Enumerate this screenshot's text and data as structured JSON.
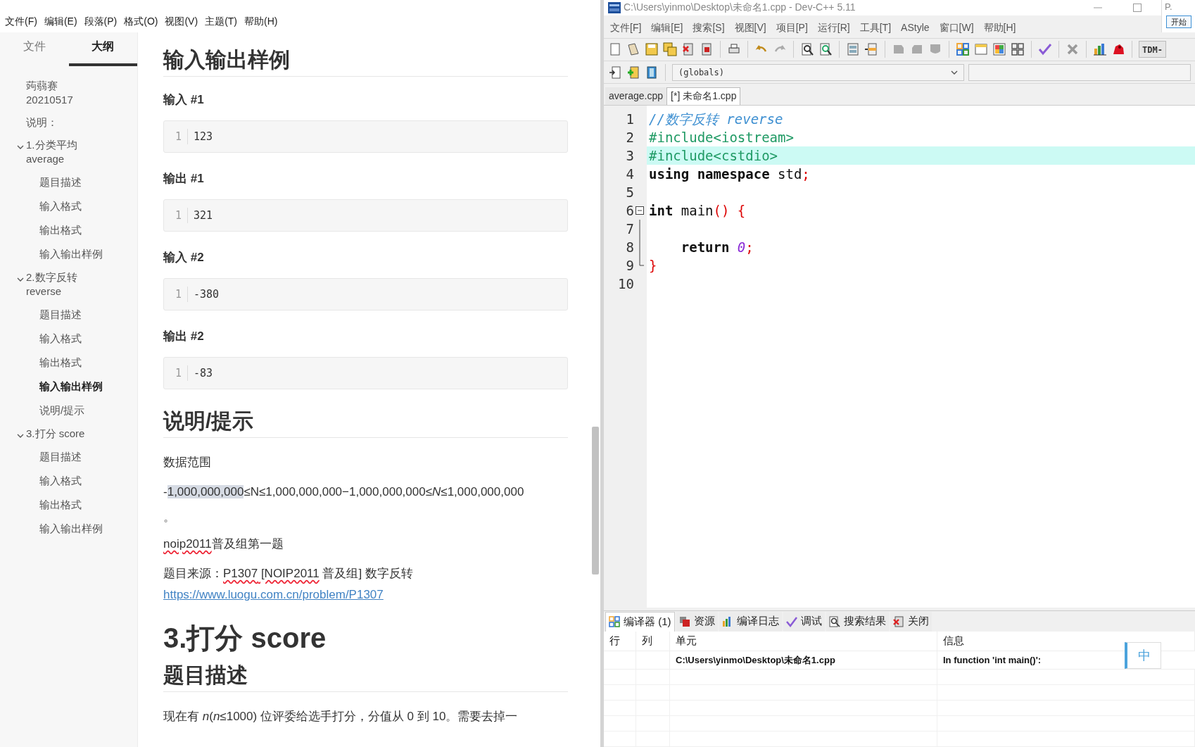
{
  "typora": {
    "menu": [
      "文件(F)",
      "编辑(E)",
      "段落(P)",
      "格式(O)",
      "视图(V)",
      "主题(T)",
      "帮助(H)"
    ],
    "sidebar_tabs": [
      {
        "label": "文件",
        "selected": false
      },
      {
        "label": "大纲",
        "selected": true
      }
    ],
    "outline": [
      {
        "label": "蒟蒻赛20210517",
        "selected": false
      },
      {
        "label": "说明：",
        "selected": false
      },
      {
        "label": "1.分类平均 average",
        "selected": false,
        "expanded": true,
        "children": [
          {
            "label": "题目描述",
            "selected": false
          },
          {
            "label": "输入格式",
            "selected": false
          },
          {
            "label": "输出格式",
            "selected": false
          },
          {
            "label": "输入输出样例",
            "selected": false
          }
        ]
      },
      {
        "label": "2.数字反转 reverse",
        "selected": false,
        "expanded": true,
        "children": [
          {
            "label": "题目描述",
            "selected": false
          },
          {
            "label": "输入格式",
            "selected": false
          },
          {
            "label": "输出格式",
            "selected": false
          },
          {
            "label": "输入输出样例",
            "selected": true
          },
          {
            "label": "说明/提示",
            "selected": false
          }
        ]
      },
      {
        "label": "3.打分 score",
        "selected": false,
        "expanded": true,
        "children": [
          {
            "label": "题目描述",
            "selected": false
          },
          {
            "label": "输入格式",
            "selected": false
          },
          {
            "label": "输出格式",
            "selected": false
          },
          {
            "label": "输入输出样例",
            "selected": false
          }
        ]
      }
    ],
    "content": [
      {
        "kind": "h2",
        "text": "输入输出样例"
      },
      {
        "kind": "h4",
        "text": "输入 #1"
      },
      {
        "kind": "code",
        "line_number": "1",
        "text": "123"
      },
      {
        "kind": "h4",
        "text": "输出 #1"
      },
      {
        "kind": "code",
        "line_number": "1",
        "text": "321"
      },
      {
        "kind": "h4",
        "text": "输入 #2"
      },
      {
        "kind": "code",
        "line_number": "1",
        "text": "-380"
      },
      {
        "kind": "h4",
        "text": "输出 #2"
      },
      {
        "kind": "code",
        "line_number": "1",
        "text": "-83"
      },
      {
        "kind": "h2",
        "text": "说明/提示"
      },
      {
        "kind": "p",
        "parts": [
          {
            "text": "数据范围",
            "misspelled": false
          }
        ]
      },
      {
        "kind": "math",
        "parts": [
          {
            "text": "-",
            "highlighted": false
          },
          {
            "text": "1,000,000,000",
            "highlighted": true
          },
          {
            "text": "≤N≤1,000,000,000−1,000,000,000≤*N*≤1,000,000,000",
            "highlighted": false
          }
        ],
        "tail": "。"
      },
      {
        "kind": "p",
        "parts": [
          {
            "text": "noip2011",
            "misspelled": true
          },
          {
            "text": "普及组第一题",
            "misspelled": false
          }
        ]
      },
      {
        "kind": "p",
        "parts": [
          {
            "text": "题目来源：",
            "misspelled": false
          },
          {
            "text": "P1307",
            "misspelled": true
          },
          {
            "text": " [NOIP2011",
            "misspelled": true
          },
          {
            "text": " 普及组] 数字反转",
            "misspelled": false
          }
        ],
        "link": "https://www.luogu.com.cn/problem/P1307"
      },
      {
        "kind": "h1",
        "text": "3.打分 score"
      },
      {
        "kind": "h2",
        "text": "题目描述"
      },
      {
        "kind": "p",
        "parts": [
          {
            "text": "现在有 *n*(*n*≤1000) 位评委给选手打分，分值从 0 到 10。需要去掉一",
            "misspelled": false
          }
        ]
      }
    ]
  },
  "devcpp": {
    "title": "C:\\Users\\yinmo\\Desktop\\未命名1.cpp - Dev-C++ 5.11",
    "menu": [
      "文件[F]",
      "编辑[E]",
      "搜索[S]",
      "视图[V]",
      "项目[P]",
      "运行[R]",
      "工具[T]",
      "AStyle",
      "窗口[W]",
      "帮助[H]"
    ],
    "compiler_box": "TDM-",
    "scope_box": "(globals)",
    "tabs": [
      {
        "label": "average.cpp",
        "selected": false
      },
      {
        "label": "[*] 未命名1.cpp",
        "selected": true
      }
    ],
    "code": [
      {
        "number": "1",
        "highlighted": false,
        "kind": "plain",
        "tokens": [
          {
            "text": "//数字反转 reverse",
            "kind": "comment"
          }
        ]
      },
      {
        "number": "2",
        "highlighted": false,
        "kind": "plain",
        "tokens": [
          {
            "text": "#include<iostream>",
            "kind": "preproc"
          }
        ]
      },
      {
        "number": "3",
        "highlighted": true,
        "kind": "plain",
        "tokens": [
          {
            "text": "#include<cstdio>",
            "kind": "preproc"
          }
        ]
      },
      {
        "number": "4",
        "highlighted": false,
        "kind": "plain",
        "tokens": [
          {
            "text": "using namespace",
            "kind": "keyword"
          },
          {
            "text": " std",
            "kind": "plain"
          },
          {
            "text": ";",
            "kind": "symbol"
          }
        ]
      },
      {
        "number": "5",
        "highlighted": false,
        "kind": "plain"
      },
      {
        "number": "6",
        "highlighted": false,
        "kind": "foldstart",
        "tokens": [
          {
            "text": "int",
            "kind": "keyword"
          },
          {
            "text": " main",
            "kind": "plain"
          },
          {
            "text": "() {",
            "kind": "symbol"
          }
        ]
      },
      {
        "number": "7",
        "highlighted": false,
        "kind": "foldbody"
      },
      {
        "number": "8",
        "highlighted": false,
        "kind": "foldbody",
        "tokens": [
          {
            "text": "    return ",
            "kind": "keyword"
          },
          {
            "text": "0",
            "kind": "number"
          },
          {
            "text": ";",
            "kind": "symbol"
          }
        ]
      },
      {
        "number": "9",
        "highlighted": false,
        "kind": "foldend",
        "tokens": [
          {
            "text": "}",
            "kind": "symbol"
          }
        ]
      },
      {
        "number": "10",
        "highlighted": false,
        "kind": "plain"
      }
    ],
    "bottom_tabs": [
      {
        "label": "编译器 (1)",
        "selected": true
      },
      {
        "label": "资源",
        "selected": false
      },
      {
        "label": "编译日志",
        "selected": false
      },
      {
        "label": "调试",
        "selected": false
      },
      {
        "label": "搜索结果",
        "selected": false
      },
      {
        "label": "关闭",
        "selected": false
      }
    ],
    "columns": [
      "行",
      "列",
      "单元",
      "信息"
    ],
    "rows": [
      {
        "unit": "C:\\Users\\yinmo\\Desktop\\未命名1.cpp",
        "message": "In function 'int main()':"
      }
    ]
  },
  "overlay": {
    "window_label": "P.",
    "start_button": "开始",
    "ime_indicator": "中"
  }
}
